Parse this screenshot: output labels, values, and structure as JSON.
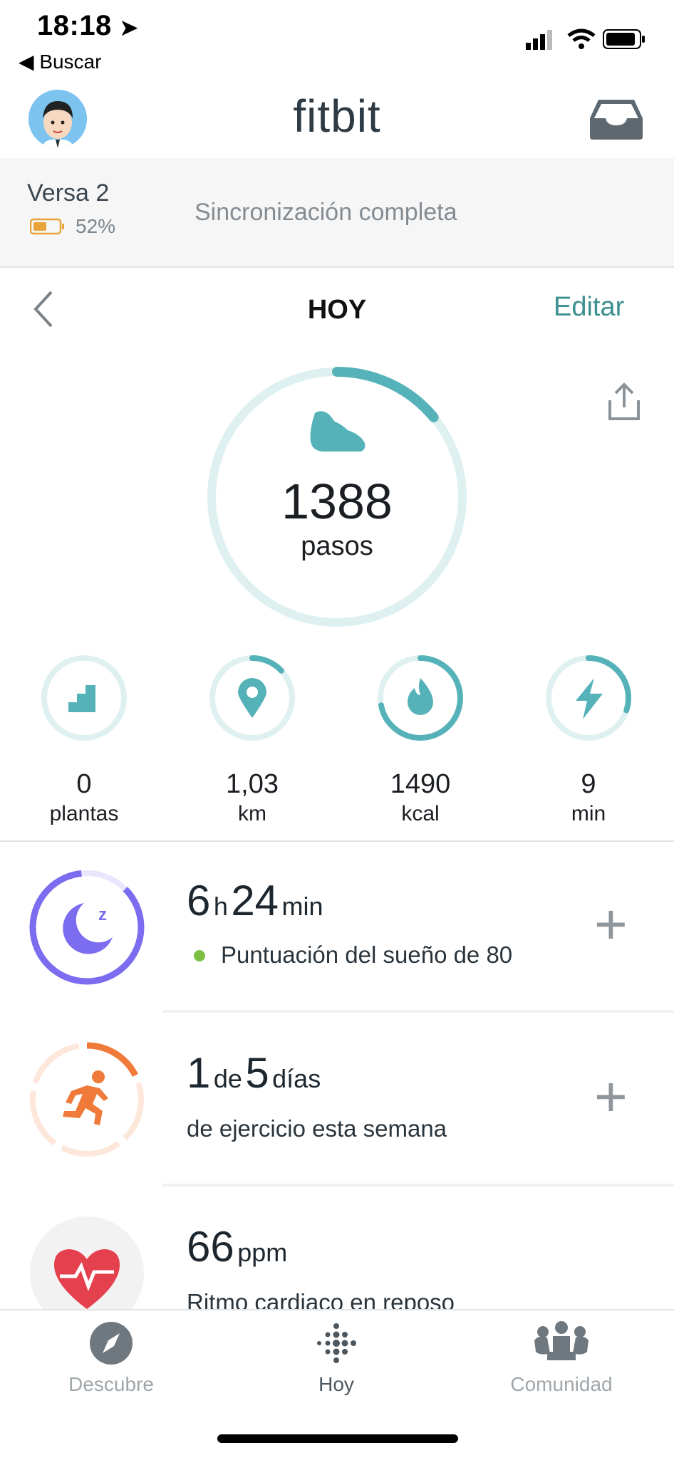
{
  "status_bar": {
    "time": "18:18",
    "back_label": "Buscar"
  },
  "header": {
    "title": "fitbit"
  },
  "device": {
    "name": "Versa 2",
    "battery": "52%",
    "sync_status": "Sincronización completa"
  },
  "day_nav": {
    "title": "HOY",
    "edit_label": "Editar"
  },
  "steps": {
    "value": "1388",
    "unit": "pasos",
    "progress": 0.14
  },
  "stats": [
    {
      "value": "0",
      "unit": "plantas",
      "icon": "stairs-icon",
      "progress": 0.0
    },
    {
      "value": "1,03",
      "unit": "km",
      "icon": "location-pin-icon",
      "progress": 0.13
    },
    {
      "value": "1490",
      "unit": "kcal",
      "icon": "flame-icon",
      "progress": 0.72
    },
    {
      "value": "9",
      "unit": "min",
      "icon": "lightning-icon",
      "progress": 0.3
    }
  ],
  "sleep": {
    "hours": "6",
    "h_label": "h",
    "minutes": "24",
    "min_label": "min",
    "score_text": "Puntuación del sueño de 80"
  },
  "exercise": {
    "done": "1",
    "de_label": "de",
    "goal": "5",
    "days_label": "días",
    "subtitle": "de ejercicio esta semana"
  },
  "heart": {
    "value": "66",
    "unit": "ppm",
    "subtitle": "Ritmo cardiaco en reposo"
  },
  "tabbar": {
    "tabs": [
      {
        "label": "Descubre",
        "icon": "compass-icon"
      },
      {
        "label": "Hoy",
        "icon": "fitbit-dots-icon"
      },
      {
        "label": "Comunidad",
        "icon": "community-icon"
      }
    ]
  },
  "colors": {
    "teal": "#56b2b9",
    "teal_light": "#dff0f1",
    "purple": "#7b6cf0",
    "orange": "#f07a3a",
    "red": "#e5404d",
    "green": "#7bc043"
  }
}
